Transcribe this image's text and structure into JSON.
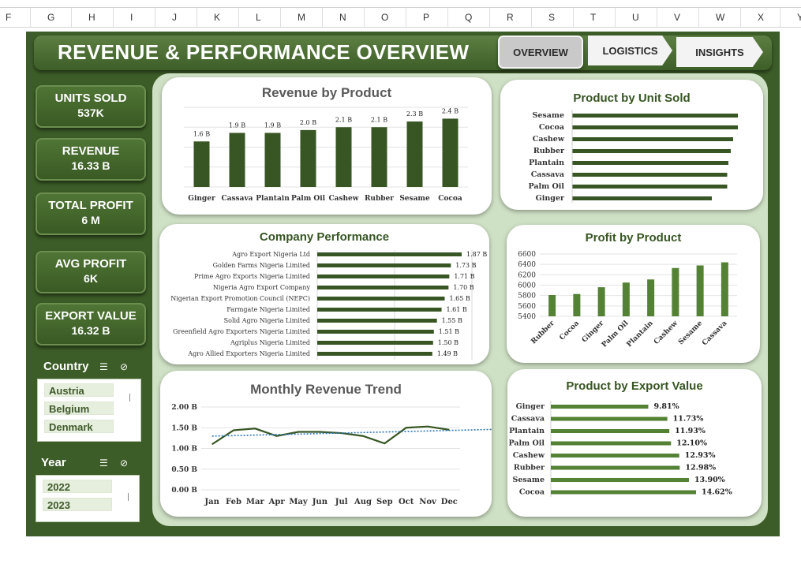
{
  "columns": [
    "F",
    "G",
    "H",
    "I",
    "J",
    "K",
    "L",
    "M",
    "N",
    "O",
    "P",
    "Q",
    "R",
    "S",
    "T",
    "U",
    "V",
    "W",
    "X",
    "Y"
  ],
  "header": {
    "title": "REVENUE & PERFORMANCE OVERVIEW",
    "tabs": [
      "OVERVIEW",
      "LOGISTICS",
      "INSIGHTS"
    ],
    "active_tab": "OVERVIEW"
  },
  "kpis": [
    {
      "label": "UNITS SOLD",
      "value": "537K"
    },
    {
      "label": "REVENUE",
      "value": "16.33 B"
    },
    {
      "label": "TOTAL PROFIT",
      "value": "6 M"
    },
    {
      "label": "AVG PROFIT",
      "value": "6K"
    },
    {
      "label": "EXPORT VALUE",
      "value": "16.32 B"
    }
  ],
  "slicers": {
    "country": {
      "title": "Country",
      "items": [
        "Austria",
        "Belgium",
        "Denmark"
      ]
    },
    "year": {
      "title": "Year",
      "items": [
        "2022",
        "2023"
      ]
    }
  },
  "colors": {
    "dark_green": "#3c5d27",
    "bar_green": "#375623",
    "bar_green_light": "#548235",
    "trend_blue": "#2e75b6"
  },
  "chart_data": [
    {
      "type": "bar",
      "title": "Revenue by Product",
      "categories": [
        "Ginger",
        "Cassava",
        "Plantain",
        "Palm Oil",
        "Cashew",
        "Rubber",
        "Sesame",
        "Cocoa"
      ],
      "values": [
        1.6,
        1.9,
        1.9,
        2.0,
        2.1,
        2.1,
        2.3,
        2.4
      ],
      "labels": [
        "1.6 B",
        "1.9 B",
        "1.9 B",
        "2.0 B",
        "2.1 B",
        "2.1 B",
        "2.3 B",
        "2.4 B"
      ],
      "ylim": [
        0,
        2.8
      ]
    },
    {
      "type": "bar",
      "orientation": "horizontal",
      "title": "Product by Unit Sold",
      "categories": [
        "Sesame",
        "Cocoa",
        "Cashew",
        "Rubber",
        "Plantain",
        "Cassava",
        "Palm Oil",
        "Ginger"
      ],
      "values": [
        70000,
        70000,
        68000,
        67000,
        66000,
        65500,
        65500,
        59000
      ]
    },
    {
      "type": "bar",
      "orientation": "horizontal",
      "title": "Company Performance",
      "categories": [
        "Agro Export Nigeria Ltd",
        "Golden Farms Nigeria Limited",
        "Prime Agro Exports Nigeria Limited",
        "Nigeria Agro Export Company",
        "Nigerian Export Promotion Council (NEPC)",
        "Farmgate Nigeria Limited",
        "Solid Agro Nigeria Limited",
        "Greenfield Agro Exporters Nigeria Limited",
        "Agriplus Nigeria Limited",
        "Agro Allied Exporters Nigeria Limited"
      ],
      "values": [
        1.87,
        1.73,
        1.71,
        1.7,
        1.65,
        1.61,
        1.55,
        1.51,
        1.5,
        1.49
      ],
      "labels": [
        "1.87 B",
        "1.73 B",
        "1.71 B",
        "1.70 B",
        "1.65 B",
        "1.61 B",
        "1.55 B",
        "1.51 B",
        "1.50 B",
        "1.49 B"
      ]
    },
    {
      "type": "bar",
      "title": "Profit by Product",
      "categories": [
        "Rubber",
        "Cocoa",
        "Ginger",
        "Palm Oil",
        "Plantain",
        "Cashew",
        "Sesame",
        "Cassava"
      ],
      "values": [
        5810,
        5830,
        5960,
        6050,
        6110,
        6330,
        6380,
        6440
      ],
      "ylim": [
        5400,
        6600
      ],
      "yticks": [
        "6600",
        "6400",
        "6200",
        "6000",
        "5800",
        "5600",
        "5400"
      ]
    },
    {
      "type": "line",
      "title": "Monthly Revenue Trend",
      "categories": [
        "Jan",
        "Feb",
        "Mar",
        "Apr",
        "May",
        "Jun",
        "Jul",
        "Aug",
        "Sep",
        "Oct",
        "Nov",
        "Dec"
      ],
      "values": [
        1.1,
        1.44,
        1.48,
        1.3,
        1.4,
        1.4,
        1.37,
        1.3,
        1.12,
        1.5,
        1.53,
        1.45
      ],
      "ylim": [
        0,
        2.0
      ],
      "yticks": [
        "2.00 B",
        "1.50 B",
        "1.00 B",
        "0.50 B",
        "0.00 B"
      ],
      "trendline": true
    },
    {
      "type": "bar",
      "orientation": "horizontal",
      "title": "Product by Export Value",
      "categories": [
        "Ginger",
        "Cassava",
        "Plantain",
        "Palm Oil",
        "Cashew",
        "Rubber",
        "Sesame",
        "Cocoa"
      ],
      "values": [
        9.81,
        11.73,
        11.93,
        12.1,
        12.93,
        12.98,
        13.9,
        14.62
      ],
      "labels": [
        "9.81%",
        "11.73%",
        "11.93%",
        "12.10%",
        "12.93%",
        "12.98%",
        "13.90%",
        "14.62%"
      ]
    }
  ]
}
